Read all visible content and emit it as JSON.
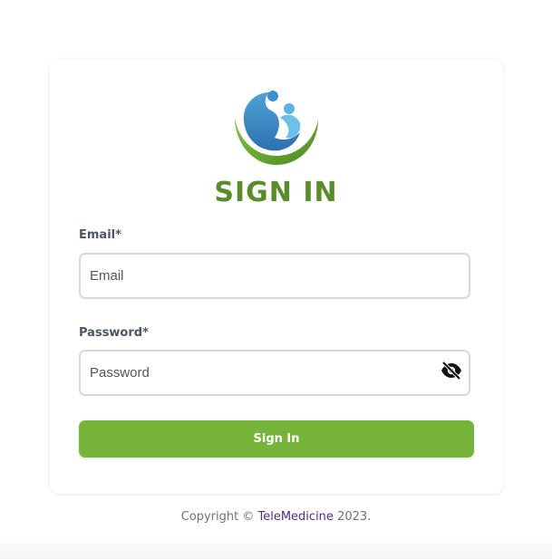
{
  "brand": {
    "logo_icon": "mother-child-logo-icon",
    "heading": "SIGN IN",
    "primary_color": "#5b8c2a",
    "button_color": "#76b53a"
  },
  "form": {
    "email": {
      "label": "Email*",
      "placeholder": "Email",
      "value": ""
    },
    "password": {
      "label": "Password*",
      "placeholder": "Password",
      "value": "",
      "toggle_icon": "eye-off-icon"
    },
    "submit_label": "Sign In"
  },
  "footer": {
    "prefix": "Copyright ©",
    "link_text": "TeleMedicine",
    "suffix": "2023."
  }
}
